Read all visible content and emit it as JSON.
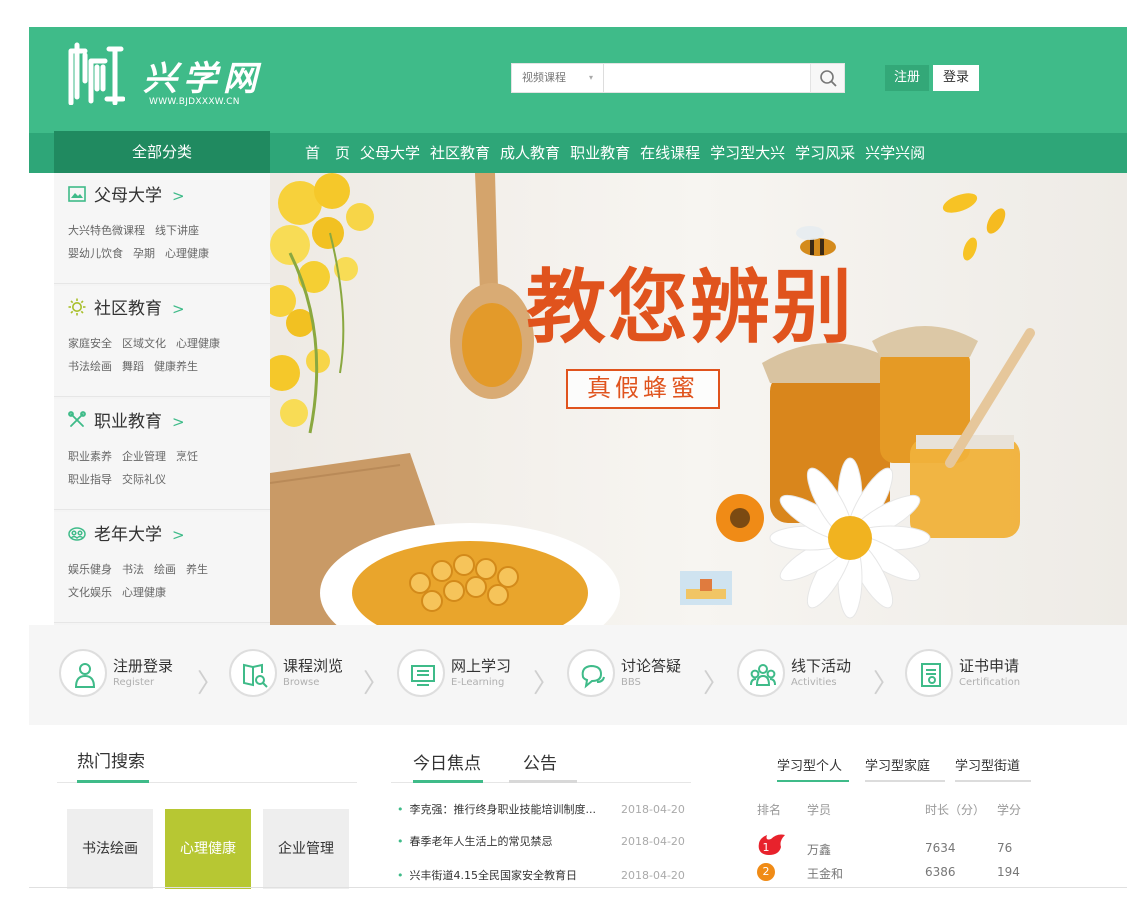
{
  "header": {
    "logo_name": "兴学网",
    "logo_url": "WWW.BJDXXXW.CN",
    "search": {
      "category": "视频课程",
      "placeholder": ""
    },
    "register_label": "注册",
    "login_label": "登录",
    "colors": {
      "brand": "#3fbb89",
      "nav": "#2ea678",
      "nav_active": "#208a60"
    }
  },
  "nav": {
    "all_categories": "全部分类",
    "items": [
      "首　页",
      "父母大学",
      "社区教育",
      "成人教育",
      "职业教育",
      "在线课程",
      "学习型大兴",
      "学习风采",
      "兴学兴阅"
    ]
  },
  "sidebar": {
    "categories": [
      {
        "title": "父母大学",
        "icon": "image-icon",
        "links": [
          [
            "大兴特色微课程",
            "线下讲座"
          ],
          [
            "婴幼儿饮食",
            "孕期",
            "心理健康"
          ]
        ]
      },
      {
        "title": "社区教育",
        "icon": "sun-icon",
        "links": [
          [
            "家庭安全",
            "区域文化",
            "心理健康"
          ],
          [
            "书法绘画",
            "舞蹈",
            "健康养生"
          ]
        ]
      },
      {
        "title": "职业教育",
        "icon": "tools-icon",
        "links": [
          [
            "职业素养",
            "企业管理",
            "烹饪"
          ],
          [
            "职业指导",
            "交际礼仪"
          ]
        ]
      },
      {
        "title": "老年大学",
        "icon": "group-icon",
        "links": [
          [
            "娱乐健身",
            "书法",
            "绘画",
            "养生"
          ],
          [
            "文化娱乐",
            "心理健康"
          ]
        ]
      }
    ]
  },
  "banner": {
    "title": "教您辨别",
    "subtitle": "真假蜂蜜",
    "thumbs": 5
  },
  "steps": [
    {
      "title": "注册登录",
      "sub": "Register",
      "icon": "user-icon"
    },
    {
      "title": "课程浏览",
      "sub": "Browse",
      "icon": "book-search-icon"
    },
    {
      "title": "网上学习",
      "sub": "E-Learning",
      "icon": "monitor-icon"
    },
    {
      "title": "讨论答疑",
      "sub": "BBS",
      "icon": "chat-icon"
    },
    {
      "title": "线下活动",
      "sub": "Activities",
      "icon": "people-icon"
    },
    {
      "title": "证书申请",
      "sub": "Certification",
      "icon": "certificate-icon"
    }
  ],
  "hot_search": {
    "title": "热门搜索",
    "tags": [
      "书法绘画",
      "心理健康",
      "企业管理"
    ],
    "active_index": 1
  },
  "news": {
    "tabs": [
      "今日焦点",
      "公告"
    ],
    "items": [
      {
        "title": "李克强：推行终身职业技能培训制度...",
        "date": "2018-04-20"
      },
      {
        "title": "春季老年人生活上的常见禁忌",
        "date": "2018-04-20"
      },
      {
        "title": "兴丰街道4.15全民国家安全教育日",
        "date": "2018-04-20"
      }
    ]
  },
  "ranking": {
    "tabs": [
      "学习型个人",
      "学习型家庭",
      "学习型街道"
    ],
    "headers": [
      "排名",
      "学员",
      "时长（分）",
      "学分"
    ],
    "rows": [
      {
        "rank": "1",
        "name": "万鑫",
        "time": "7634",
        "credit": "76"
      },
      {
        "rank": "2",
        "name": "王金和",
        "time": "6386",
        "credit": "194"
      }
    ]
  }
}
